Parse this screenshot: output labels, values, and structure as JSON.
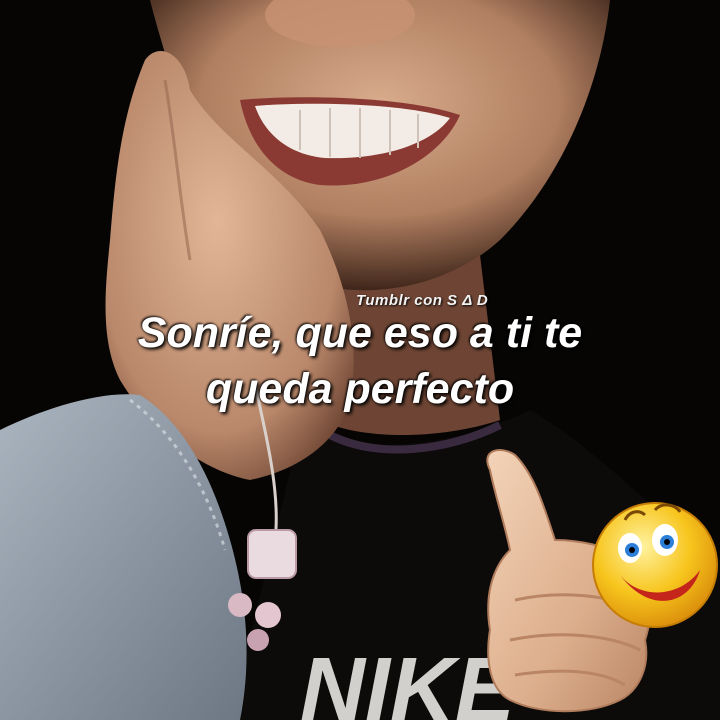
{
  "watermark": "Tumblr con S Δ D",
  "caption": {
    "line1": "Sonríe, que eso a ti te",
    "line2": "queda perfecto"
  },
  "shirt_text": "NIKE",
  "icons": {
    "thumbs_up": "thumbs-up-icon",
    "emoji": "laughing-emoji-icon"
  },
  "colors": {
    "background": "#050403",
    "skin": "#c99a7a",
    "caption_text": "#ffffff",
    "emoji": "#f5c518"
  }
}
